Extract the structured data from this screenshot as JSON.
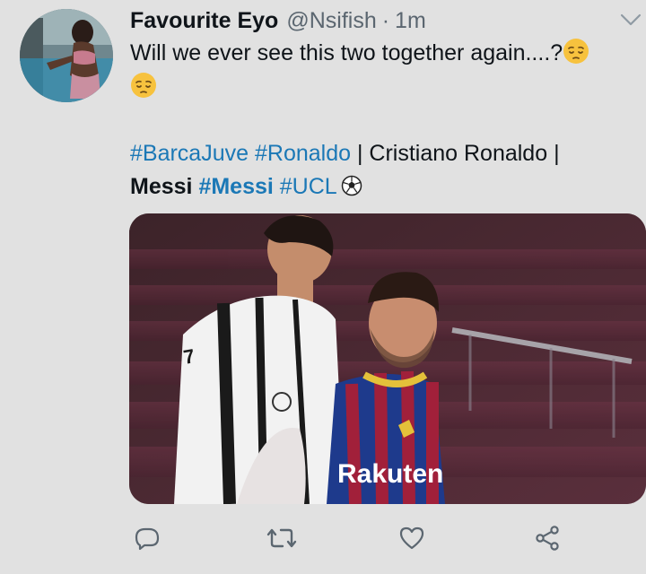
{
  "tweet": {
    "display_name": "Favourite Eyo",
    "handle": "@Nsifish",
    "separator": "·",
    "time": "1m",
    "text": "Will we ever see this two together again....?",
    "emoji_icon": "pensive-face-emoji",
    "tags": {
      "tag1": "#BarcaJuve",
      "tag2": "#Ronaldo",
      "plain1": " | Cristiano Ronaldo |",
      "bold1": "Messi",
      "tag3": "#Messi",
      "tag4": "#UCL",
      "ball_icon": "soccer-ball-icon"
    },
    "media": {
      "jersey_text": "Rakuten"
    }
  },
  "actions": {
    "reply_icon": "reply-icon",
    "retweet_icon": "retweet-icon",
    "like_icon": "heart-icon",
    "share_icon": "share-icon"
  },
  "colors": {
    "background": "#e1e1e1",
    "link": "#1b78b6",
    "secondary_text": "#5b6670",
    "icon": "#5b6670"
  }
}
